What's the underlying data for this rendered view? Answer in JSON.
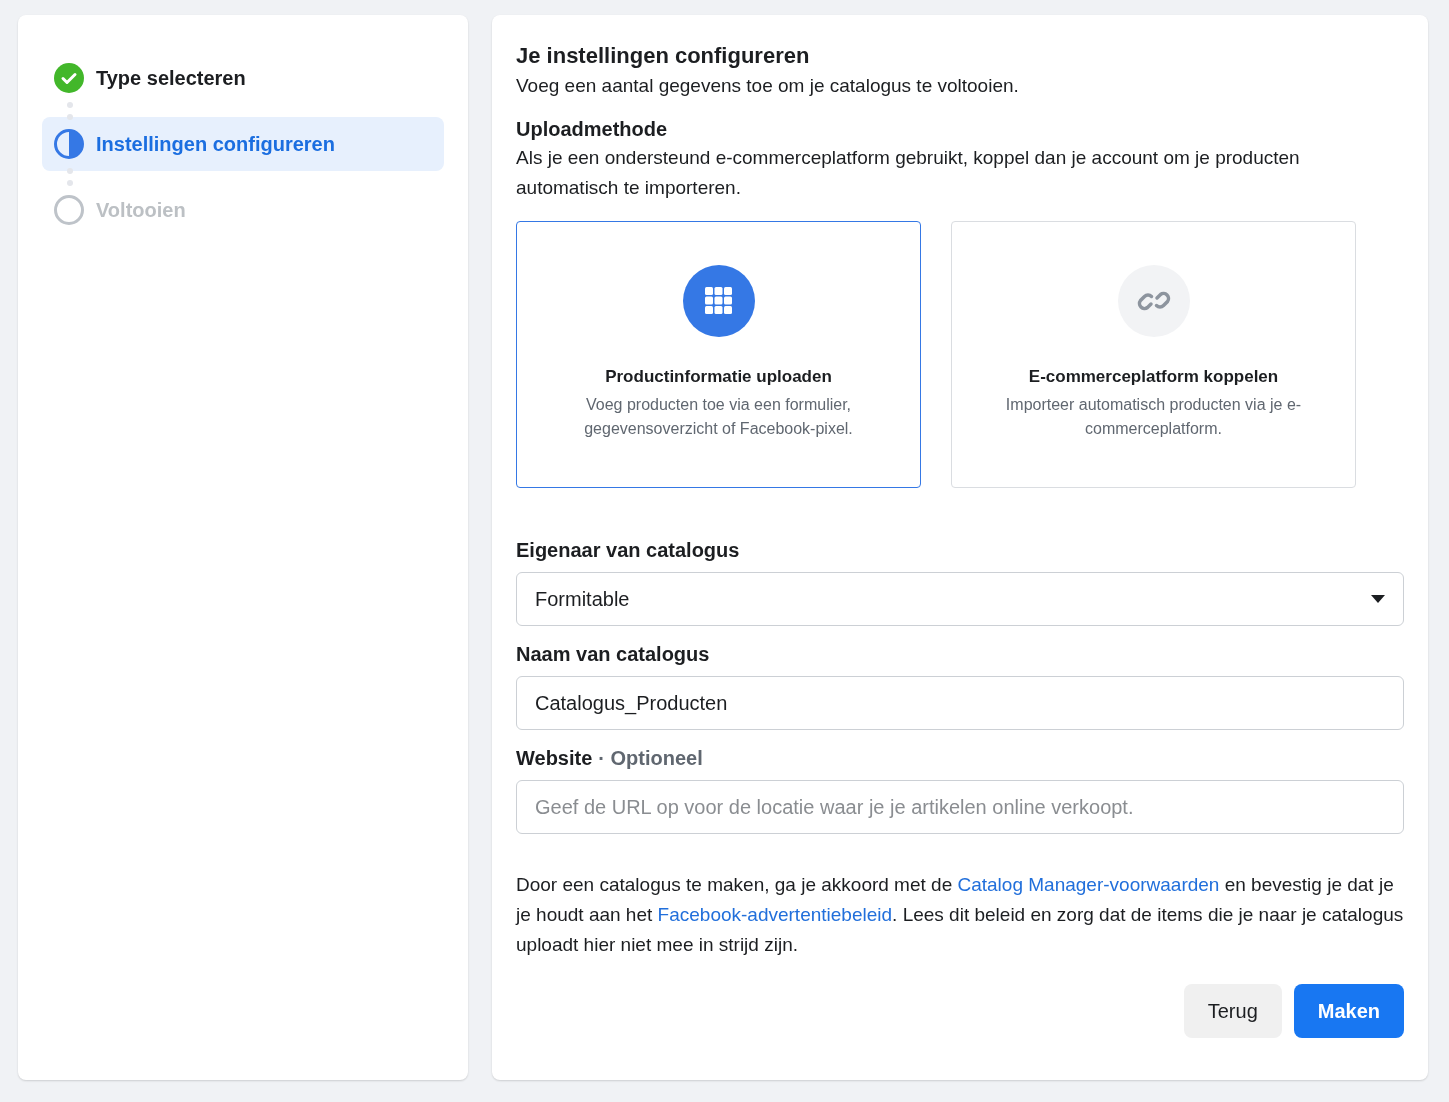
{
  "steps": [
    {
      "label": "Type selecteren",
      "kind": "done",
      "selected": false
    },
    {
      "label": "Instellingen configureren",
      "kind": "current",
      "selected": true
    },
    {
      "label": "Voltooien",
      "kind": "todo",
      "selected": false
    }
  ],
  "header": {
    "title": "Je instellingen configureren",
    "subtitle": "Voeg een aantal gegevens toe om je catalogus te voltooien."
  },
  "upload_method": {
    "title": "Uploadmethode",
    "description": "Als je een ondersteund e-commerceplatform gebruikt, koppel dan je account om je producten automatisch te importeren.",
    "options": [
      {
        "kind": "grid",
        "title": "Productinformatie uploaden",
        "description": "Voeg producten toe via een formulier, gegevensoverzicht of Facebook-pixel.",
        "selected": true
      },
      {
        "kind": "link",
        "title": "E-commerceplatform koppelen",
        "description": "Importeer automatisch producten via je e-commerceplatform.",
        "selected": false
      }
    ]
  },
  "fields": [
    {
      "kind": "select",
      "label": "Eigenaar van catalogus",
      "value": "Formitable"
    },
    {
      "kind": "text",
      "label": "Naam van catalogus",
      "value": "Catalogus_Producten"
    },
    {
      "kind": "text",
      "label": "Website",
      "optional": "· Optioneel",
      "placeholder": "Geef de URL op voor de locatie waar je je artikelen online verkoopt."
    }
  ],
  "consent": [
    {
      "kind": "text",
      "text": "Door een catalogus te maken, ga je akkoord met de "
    },
    {
      "kind": "link",
      "text": "Catalog Manager-voorwaarden"
    },
    {
      "kind": "text",
      "text": " en bevestig je dat je je houdt aan het "
    },
    {
      "kind": "link",
      "text": "Facebook-advertentiebeleid"
    },
    {
      "kind": "text",
      "text": ". Lees dit beleid en zorg dat de items die je naar je catalogus uploadt hier niet mee in strijd zijn."
    }
  ],
  "buttons": [
    {
      "kind": "secondary",
      "label": "Terug"
    },
    {
      "kind": "primary",
      "label": "Maken"
    }
  ]
}
